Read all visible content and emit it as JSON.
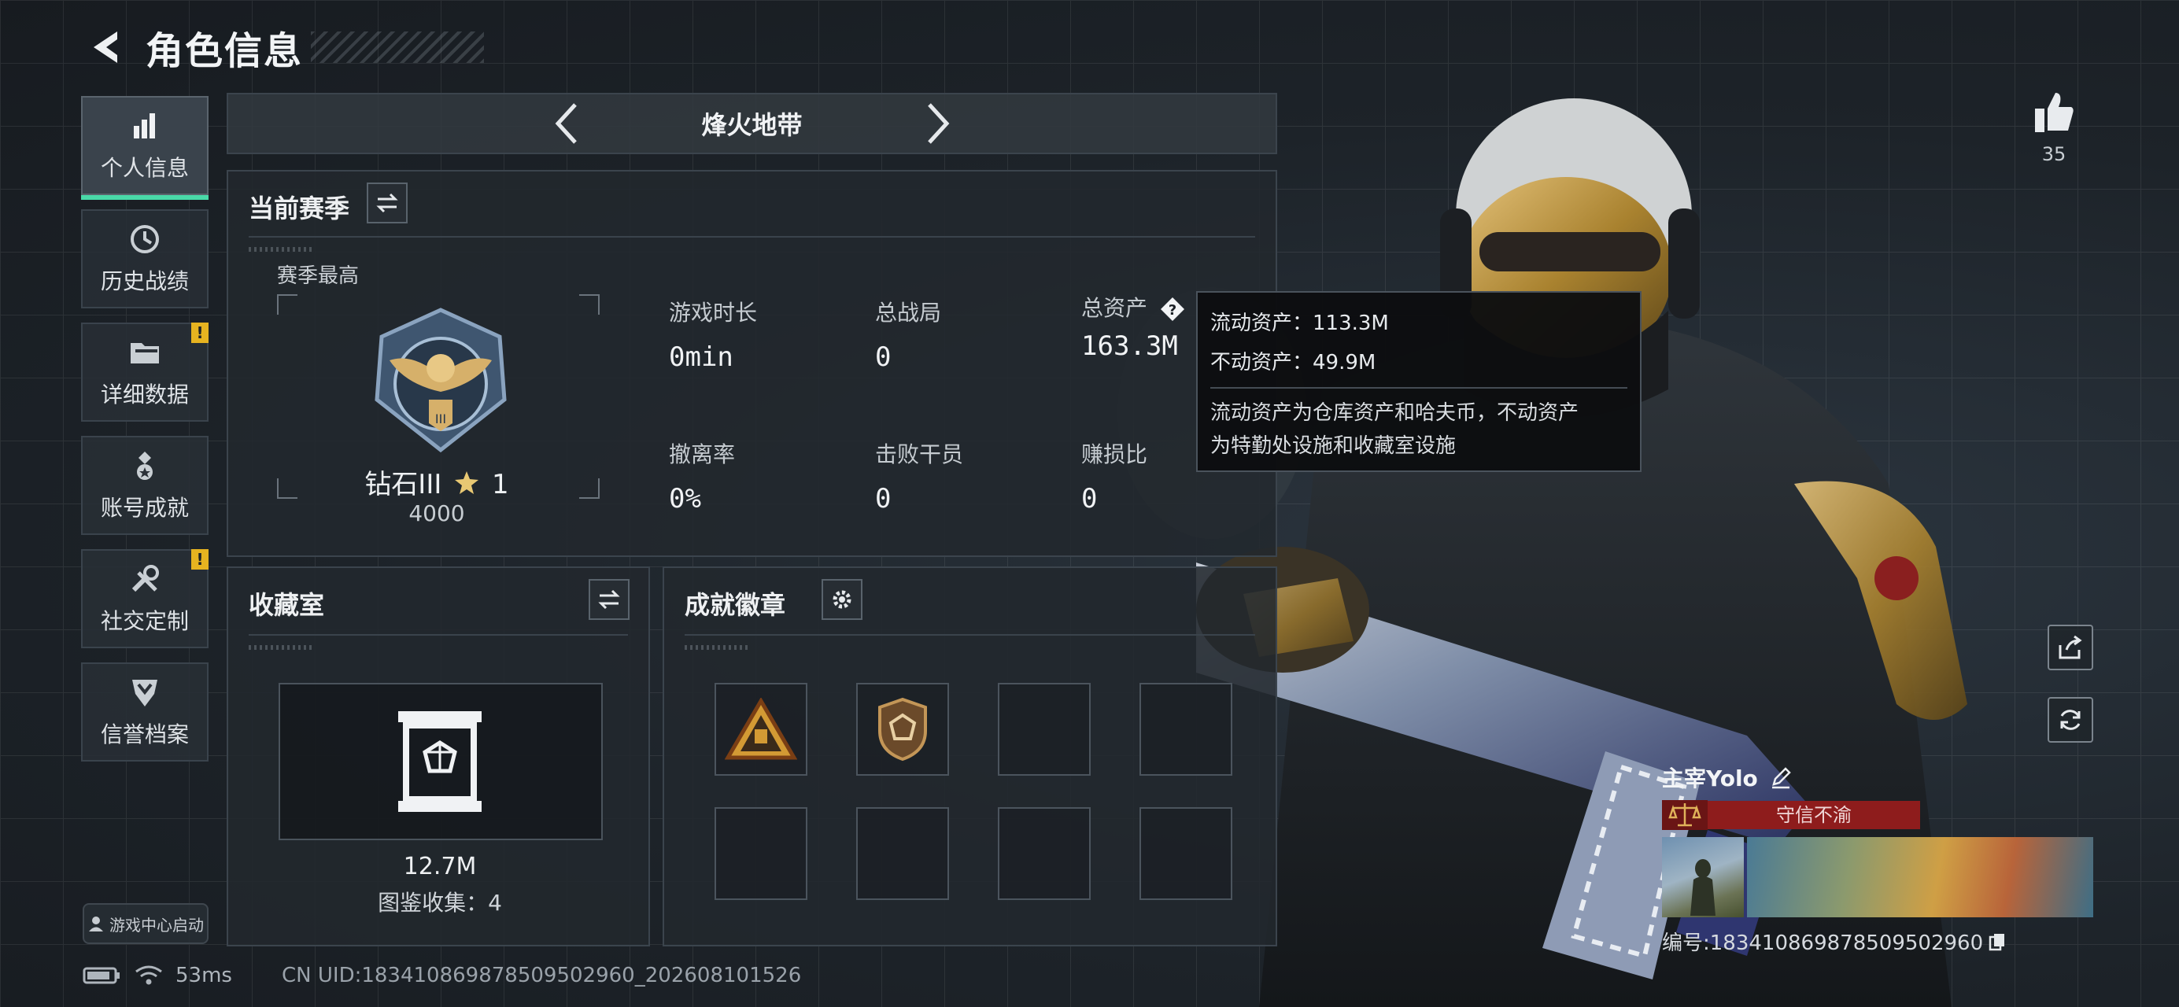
{
  "header": {
    "title": "角色信息",
    "back_icon": "back-arrow-icon"
  },
  "nav": {
    "items": [
      {
        "label": "个人信息",
        "icon": "bar-chart-icon",
        "active": true,
        "alert": false
      },
      {
        "label": "历史战绩",
        "icon": "clock-history-icon",
        "active": false,
        "alert": false
      },
      {
        "label": "详细数据",
        "icon": "folder-icon",
        "active": false,
        "alert": true
      },
      {
        "label": "账号成就",
        "icon": "medal-icon",
        "active": false,
        "alert": false
      },
      {
        "label": "社交定制",
        "icon": "tools-icon",
        "active": false,
        "alert": true
      },
      {
        "label": "信誉档案",
        "icon": "shield-chevron-icon",
        "active": false,
        "alert": false
      }
    ],
    "alert_mark": "!",
    "game_center": "游戏中心启动"
  },
  "mode": {
    "title": "烽火地带"
  },
  "season": {
    "title": "当前赛季",
    "best_label": "赛季最高",
    "rank_name": "钻石III",
    "rank_stars": "1",
    "rank_score": "4000",
    "stats": [
      {
        "label": "游戏时长",
        "value": "0min"
      },
      {
        "label": "总战局",
        "value": "0"
      },
      {
        "label": "总资产",
        "value": "163.3M",
        "has_help": true
      },
      {
        "label": "撤离率",
        "value": "0%"
      },
      {
        "label": "击败干员",
        "value": "0"
      },
      {
        "label": "赚损比",
        "value": "0"
      }
    ]
  },
  "tooltip": {
    "liquid": "流动资产：113.3M",
    "fixed": "不动资产：49.9M",
    "note_line1": "流动资产为仓库资产和哈夫币，不动资产",
    "note_line2": "为特勤处设施和收藏室设施"
  },
  "collection": {
    "title": "收藏室",
    "value": "12.7M",
    "count": "图鉴收集：4"
  },
  "achievements": {
    "title": "成就徽章",
    "slots": [
      "triangle-badge",
      "shield-badge",
      "",
      "",
      "",
      "",
      "",
      ""
    ]
  },
  "right": {
    "likes": "35",
    "like_icon": "thumbs-up-icon",
    "share_icon": "share-icon",
    "refresh_icon": "refresh-icon"
  },
  "player": {
    "name": "主宰Yolo",
    "trust": "守信不渝",
    "id": "编号:18341086987850950296​0"
  },
  "status": {
    "ping": "53ms",
    "uid": "CN UID:18341086987850950296​0_202608101526"
  },
  "colors": {
    "accent": "#49d9a8",
    "warning": "#e6b320",
    "trust_red": "#8e1c1c"
  }
}
